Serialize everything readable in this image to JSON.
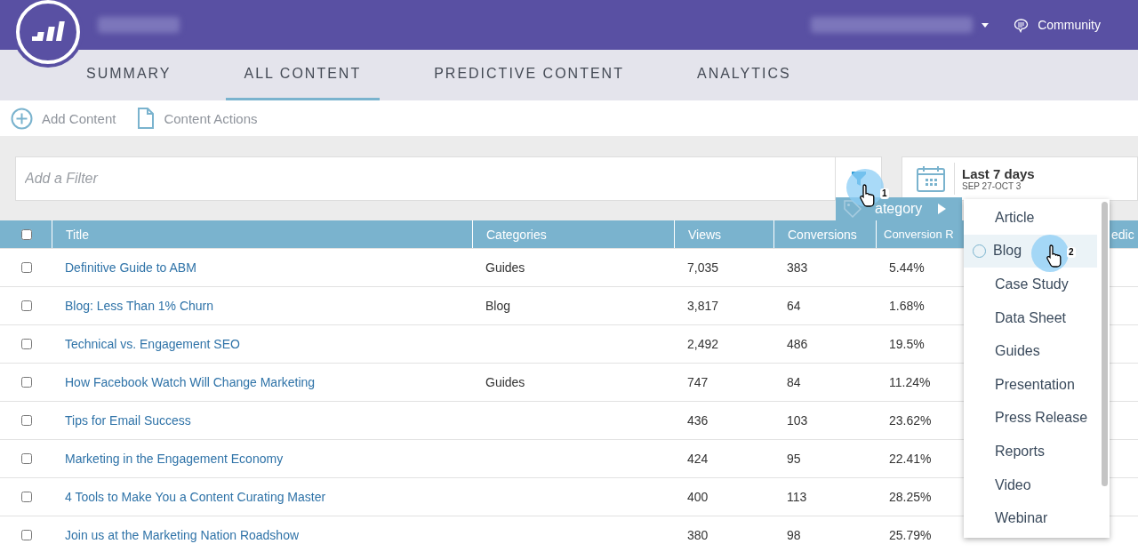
{
  "header": {
    "community": "Community"
  },
  "tabs": [
    {
      "label": "SUMMARY",
      "selected": false
    },
    {
      "label": "ALL CONTENT",
      "selected": true
    },
    {
      "label": "PREDICTIVE CONTENT",
      "selected": false
    },
    {
      "label": "ANALYTICS",
      "selected": false
    }
  ],
  "toolbar": [
    {
      "label": "Add Content",
      "kind": "add"
    },
    {
      "label": "Content Actions",
      "kind": "doc"
    }
  ],
  "filter": {
    "placeholder": "Add a Filter"
  },
  "date_range": {
    "label": "Last 7 days",
    "range": "SEP 27-OCT 3"
  },
  "table": {
    "all_checked": false,
    "columns": [
      "Title",
      "Categories",
      "Views",
      "Conversions",
      "Conversion R",
      "edic"
    ],
    "rows": [
      {
        "checked": false,
        "cells": [
          "Definitive Guide to ABM",
          "Guides",
          "7,035",
          "383",
          "5.44%"
        ]
      },
      {
        "checked": false,
        "cells": [
          "Blog: Less Than 1% Churn",
          "Blog",
          "3,817",
          "64",
          "1.68%"
        ]
      },
      {
        "checked": false,
        "cells": [
          "Technical vs. Engagement SEO",
          "",
          "2,492",
          "486",
          "19.5%"
        ]
      },
      {
        "checked": false,
        "cells": [
          "How Facebook Watch Will Change Marketing",
          "Guides",
          "747",
          "84",
          "11.24%"
        ]
      },
      {
        "checked": false,
        "cells": [
          "Tips for Email Success",
          "",
          "436",
          "103",
          "23.62%"
        ]
      },
      {
        "checked": false,
        "cells": [
          "Marketing in the Engagement Economy",
          "",
          "424",
          "95",
          "22.41%"
        ]
      },
      {
        "checked": false,
        "cells": [
          "4 Tools to Make You a Content Curating Master",
          "",
          "400",
          "113",
          "28.25%"
        ]
      },
      {
        "checked": false,
        "cells": [
          "Join us at the Marketing Nation Roadshow",
          "",
          "380",
          "98",
          "25.79%"
        ]
      }
    ]
  },
  "filter_menu": {
    "label": "ategory"
  },
  "category_options": [
    {
      "label": "Article",
      "selected": false
    },
    {
      "label": "Blog",
      "selected": true
    },
    {
      "label": "Case Study",
      "selected": false
    },
    {
      "label": "Data Sheet",
      "selected": false
    },
    {
      "label": "Guides",
      "selected": false
    },
    {
      "label": "Presentation",
      "selected": false
    },
    {
      "label": "Press Release",
      "selected": false
    },
    {
      "label": "Reports",
      "selected": false
    },
    {
      "label": "Video",
      "selected": false
    },
    {
      "label": "Webinar",
      "selected": false
    }
  ],
  "steps": [
    "1",
    "2"
  ]
}
